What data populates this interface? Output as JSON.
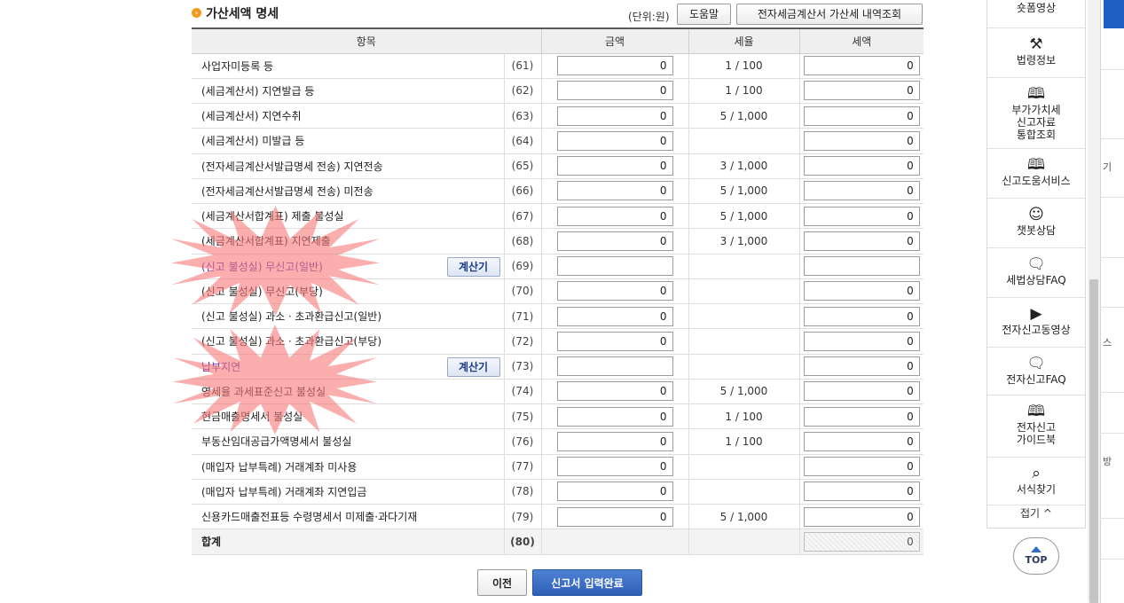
{
  "section": {
    "title": "가산세액 명세",
    "bullet": "›",
    "unit": "(단위:원)",
    "help_button": "도움말",
    "inquiry_button": "전자세금계산서 가산세 내역조회"
  },
  "table": {
    "headers": {
      "item": "항목",
      "amount": "금액",
      "rate": "세율",
      "tax": "세액"
    },
    "calc_label": "계산기",
    "rows": [
      {
        "label": "사업자미등록 등",
        "code": "(61)",
        "amount": "0",
        "rate": "1 / 100",
        "tax": "0"
      },
      {
        "label": "(세금계산서) 지연발급 등",
        "code": "(62)",
        "amount": "0",
        "rate": "1 / 100",
        "tax": "0"
      },
      {
        "label": "(세금계산서) 지연수취",
        "code": "(63)",
        "amount": "0",
        "rate": "5 / 1,000",
        "tax": "0"
      },
      {
        "label": "(세금계산서) 미발급 등",
        "code": "(64)",
        "amount": "0",
        "rate": "",
        "tax": "0"
      },
      {
        "label": "(전자세금계산서발급명세 전송) 지연전송",
        "code": "(65)",
        "amount": "0",
        "rate": "3 / 1,000",
        "tax": "0"
      },
      {
        "label": "(전자세금계산서발급명세 전송) 미전송",
        "code": "(66)",
        "amount": "0",
        "rate": "5 / 1,000",
        "tax": "0"
      },
      {
        "label": "(세금계산서합계표) 제출 불성실",
        "code": "(67)",
        "amount": "0",
        "rate": "5 / 1,000",
        "tax": "0"
      },
      {
        "label": "(세금계산서합계표) 지연제출",
        "code": "(68)",
        "amount": "0",
        "rate": "3 / 1,000",
        "tax": "0"
      },
      {
        "label": "(신고 불성실) 무신고(일반)",
        "code": "(69)",
        "amount": "",
        "rate": "",
        "tax": ""
      },
      {
        "label": "(신고 불성실) 무신고(부당)",
        "code": "(70)",
        "amount": "0",
        "rate": "",
        "tax": "0"
      },
      {
        "label": "(신고 불성실) 과소ㆍ초과환급신고(일반)",
        "code": "(71)",
        "amount": "0",
        "rate": "",
        "tax": "0"
      },
      {
        "label": "(신고 불성실) 과소ㆍ초과환급신고(부당)",
        "code": "(72)",
        "amount": "0",
        "rate": "",
        "tax": "0"
      },
      {
        "label": "납부지연",
        "code": "(73)",
        "amount": "",
        "rate": "",
        "tax": "0"
      },
      {
        "label": "영세율 과세표준신고 불성실",
        "code": "(74)",
        "amount": "0",
        "rate": "5 / 1,000",
        "tax": "0"
      },
      {
        "label": "현금매출명세서 불성실",
        "code": "(75)",
        "amount": "0",
        "rate": "1 / 100",
        "tax": "0"
      },
      {
        "label": "부동산임대공급가액명세서 불성실",
        "code": "(76)",
        "amount": "0",
        "rate": "1 / 100",
        "tax": "0"
      },
      {
        "label": "(매입자 납부특례) 거래계좌 미사용",
        "code": "(77)",
        "amount": "0",
        "rate": "",
        "tax": "0"
      },
      {
        "label": "(매입자 납부특례) 거래계좌 지연입금",
        "code": "(78)",
        "amount": "0",
        "rate": "",
        "tax": "0"
      },
      {
        "label": "신용카드매출전표등 수령명세서 미제출·과다기재",
        "code": "(79)",
        "amount": "0",
        "rate": "5 / 1,000",
        "tax": "0"
      }
    ],
    "total": {
      "label": "합계",
      "code": "(80)",
      "tax": "0"
    }
  },
  "buttons": {
    "prev": "이전",
    "complete": "신고서 입력완료"
  },
  "quick_menu": {
    "items": [
      {
        "label": "숏폼영상",
        "icon": "video-icon"
      },
      {
        "label": "법령정보",
        "icon": "gavel-icon"
      },
      {
        "label": "부가가치세\n신고자료\n통합조회",
        "icon": "book-icon"
      },
      {
        "label": "신고도움서비스",
        "icon": "book-icon"
      },
      {
        "label": "챗봇상담",
        "icon": "chatbot-icon"
      },
      {
        "label": "세법상담FAQ",
        "icon": "speech-bubble-icon"
      },
      {
        "label": "전자신고동영상",
        "icon": "play-icon"
      },
      {
        "label": "전자신고FAQ",
        "icon": "speech-bubble-icon"
      },
      {
        "label": "전자신고\n가이드북",
        "icon": "book-icon"
      },
      {
        "label": "서식찾기",
        "icon": "search-icon"
      }
    ],
    "fold": "접기 ^",
    "top": "TOP"
  },
  "side_chars": [
    "기",
    "스",
    "방"
  ],
  "colors": {
    "primary_button": "#2c5fb6",
    "highlight_text": "#5a1fb0",
    "annotation": "#f87878",
    "bullet": "#f29a1e"
  }
}
